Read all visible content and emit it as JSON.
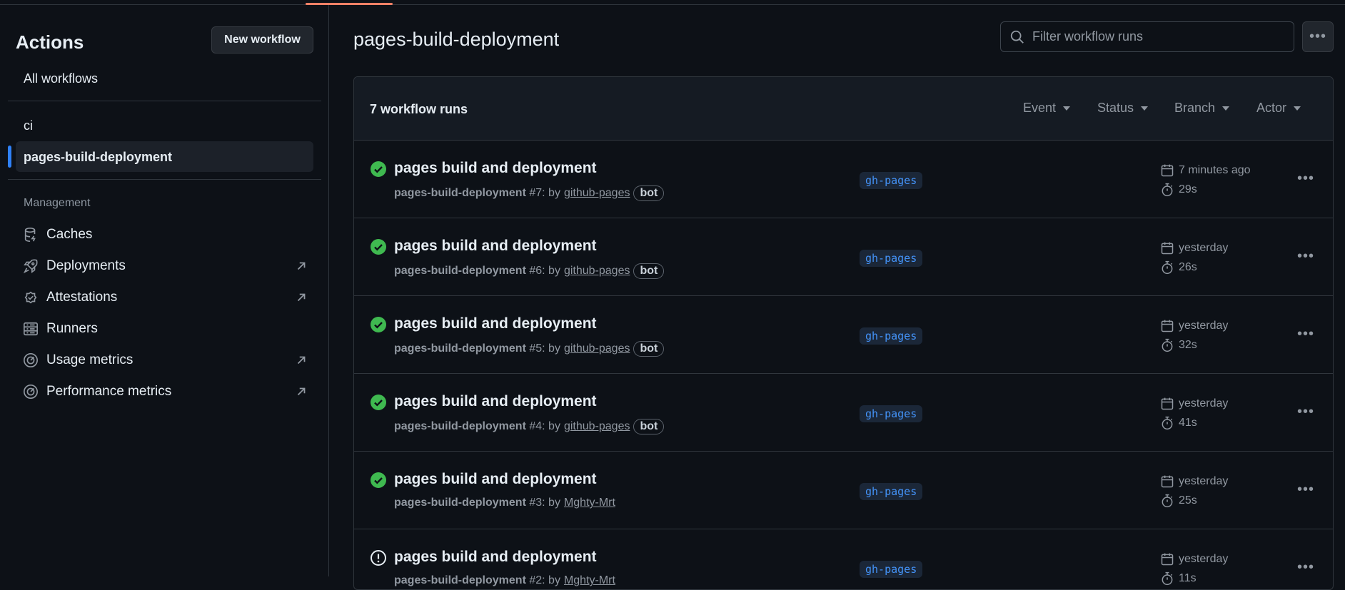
{
  "sidebar": {
    "title": "Actions",
    "new_workflow": "New workflow",
    "all_workflows": "All workflows",
    "workflows": [
      "ci",
      "pages-build-deployment"
    ],
    "management_label": "Management",
    "management": [
      {
        "label": "Caches",
        "icon": "database-icon",
        "external": false
      },
      {
        "label": "Deployments",
        "icon": "rocket-icon",
        "external": true
      },
      {
        "label": "Attestations",
        "icon": "verified-icon",
        "external": true
      },
      {
        "label": "Runners",
        "icon": "server-icon",
        "external": false
      },
      {
        "label": "Usage metrics",
        "icon": "meter-icon",
        "external": true
      },
      {
        "label": "Performance metrics",
        "icon": "meter-icon",
        "external": true
      }
    ]
  },
  "main": {
    "title": "pages-build-deployment",
    "search_placeholder": "Filter workflow runs",
    "runs_count": "7 workflow runs",
    "filters": [
      "Event",
      "Status",
      "Branch",
      "Actor"
    ],
    "runs": [
      {
        "status": "success",
        "title": "pages build and deployment",
        "workflow": "pages-build-deployment",
        "number": "#7: by",
        "user": "github-pages",
        "bot": "bot",
        "branch": "gh-pages",
        "when": "7 minutes ago",
        "duration": "29s"
      },
      {
        "status": "success",
        "title": "pages build and deployment",
        "workflow": "pages-build-deployment",
        "number": "#6: by",
        "user": "github-pages",
        "bot": "bot",
        "branch": "gh-pages",
        "when": "yesterday",
        "duration": "26s"
      },
      {
        "status": "success",
        "title": "pages build and deployment",
        "workflow": "pages-build-deployment",
        "number": "#5: by",
        "user": "github-pages",
        "bot": "bot",
        "branch": "gh-pages",
        "when": "yesterday",
        "duration": "32s"
      },
      {
        "status": "success",
        "title": "pages build and deployment",
        "workflow": "pages-build-deployment",
        "number": "#4: by",
        "user": "github-pages",
        "bot": "bot",
        "branch": "gh-pages",
        "when": "yesterday",
        "duration": "41s"
      },
      {
        "status": "success",
        "title": "pages build and deployment",
        "workflow": "pages-build-deployment",
        "number": "#3: by",
        "user": "Mghty-Mrt",
        "bot": null,
        "branch": "gh-pages",
        "when": "yesterday",
        "duration": "25s"
      },
      {
        "status": "warning",
        "title": "pages build and deployment",
        "workflow": "pages-build-deployment",
        "number": "#2: by",
        "user": "Mghty-Mrt",
        "bot": null,
        "branch": "gh-pages",
        "when": "yesterday",
        "duration": "11s"
      }
    ]
  },
  "colors": {
    "background": "#0d1117",
    "success": "#3fb950",
    "accent": "#2f81f7",
    "branch_text": "#4493f8"
  }
}
